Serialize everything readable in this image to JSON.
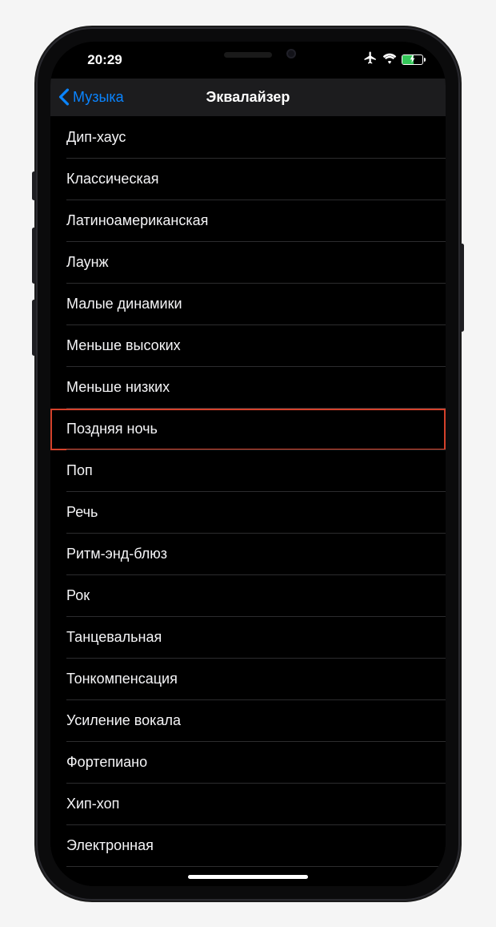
{
  "status": {
    "time": "20:29"
  },
  "nav": {
    "back_label": "Музыка",
    "title": "Эквалайзер"
  },
  "list": {
    "items": [
      {
        "label": "Дип-хаус",
        "highlight": false
      },
      {
        "label": "Классическая",
        "highlight": false
      },
      {
        "label": "Латиноамериканская",
        "highlight": false
      },
      {
        "label": "Лаунж",
        "highlight": false
      },
      {
        "label": "Малые динамики",
        "highlight": false
      },
      {
        "label": "Меньше высоких",
        "highlight": false
      },
      {
        "label": "Меньше низких",
        "highlight": false
      },
      {
        "label": "Поздняя ночь",
        "highlight": true
      },
      {
        "label": "Поп",
        "highlight": false
      },
      {
        "label": "Речь",
        "highlight": false
      },
      {
        "label": "Ритм-энд-блюз",
        "highlight": false
      },
      {
        "label": "Рок",
        "highlight": false
      },
      {
        "label": "Танцевальная",
        "highlight": false
      },
      {
        "label": "Тонкомпенсация",
        "highlight": false
      },
      {
        "label": "Усиление вокала",
        "highlight": false
      },
      {
        "label": "Фортепиано",
        "highlight": false
      },
      {
        "label": "Хип-хоп",
        "highlight": false
      },
      {
        "label": "Электронная",
        "highlight": false
      }
    ]
  }
}
